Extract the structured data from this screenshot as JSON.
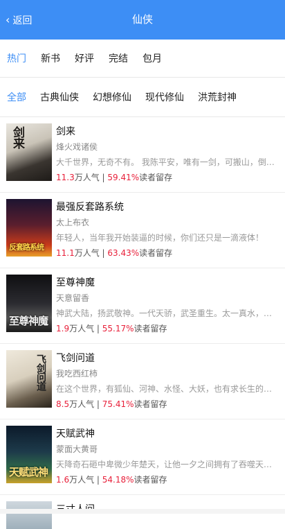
{
  "header": {
    "back_label": "返回",
    "title": "仙侠"
  },
  "tabs": [
    {
      "label": "热门",
      "active": true
    },
    {
      "label": "新书",
      "active": false
    },
    {
      "label": "好评",
      "active": false
    },
    {
      "label": "完结",
      "active": false
    },
    {
      "label": "包月",
      "active": false
    }
  ],
  "categories": [
    {
      "label": "全部",
      "active": true
    },
    {
      "label": "古典仙侠",
      "active": false
    },
    {
      "label": "幻想修仙",
      "active": false
    },
    {
      "label": "现代修仙",
      "active": false
    },
    {
      "label": "洪荒封神",
      "active": false
    }
  ],
  "colors": {
    "accent": "#3d8ef5",
    "highlight": "#e8203a"
  },
  "books": [
    {
      "title": "剑来",
      "author": "烽火戏诸侯",
      "desc": "大千世界，无奇不有。 我陈平安，唯有一剑，可搬山，倒海，降妖，镇魔，敕神，摘星，断江，摧城，开天！",
      "popularity": "11.3",
      "pop_unit": "万人气",
      "retention": "59.41%",
      "ret_unit": "读者留存",
      "cover_text": "剑来"
    },
    {
      "title": "最强反套路系统",
      "author": "太上布衣",
      "desc": "年轻人，当年我开始装逼的时候，你们还只是一滴液体！",
      "popularity": "11.1",
      "pop_unit": "万人气",
      "retention": "63.43%",
      "ret_unit": "读者留存",
      "cover_text": "反套路系统"
    },
    {
      "title": "至尊神魔",
      "author": "天意留香",
      "desc": "神武大陆，扬武敬神。一代天骄，武圣重生。太一真水，炼神锻魔",
      "popularity": "1.9",
      "pop_unit": "万人气",
      "retention": "55.17%",
      "ret_unit": "读者留存",
      "cover_text": "至尊神魔"
    },
    {
      "title": "飞剑问道",
      "author": "我吃西红柿",
      "desc": "在这个世界，有狐仙、河神、水怪、大妖，也有求长生的修行者。",
      "popularity": "8.5",
      "pop_unit": "万人气",
      "retention": "75.41%",
      "ret_unit": "读者留存",
      "cover_text": "飞剑问道"
    },
    {
      "title": "天赋武神",
      "author": "蒙面大黄哥",
      "desc": "天降奇石砸中卑微少年楚天，让他一夕之间拥有了吞噬天地的能力",
      "popularity": "1.6",
      "pop_unit": "万人气",
      "retention": "54.18%",
      "ret_unit": "读者留存",
      "cover_text": "天赋武神"
    }
  ],
  "partial_book": {
    "title": "三寸人间"
  }
}
